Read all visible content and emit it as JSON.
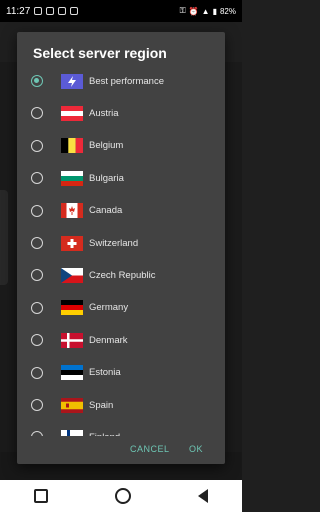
{
  "status": {
    "time": "11:27",
    "battery_text": "82%"
  },
  "dialog": {
    "title": "Select server region",
    "cancel_label": "CANCEL",
    "ok_label": "OK",
    "selected_index": 0
  },
  "regions": [
    {
      "label": "Best performance",
      "flag": "bolt"
    },
    {
      "label": "Austria",
      "flag": "at"
    },
    {
      "label": "Belgium",
      "flag": "be"
    },
    {
      "label": "Bulgaria",
      "flag": "bg"
    },
    {
      "label": "Canada",
      "flag": "ca"
    },
    {
      "label": "Switzerland",
      "flag": "ch"
    },
    {
      "label": "Czech Republic",
      "flag": "cz"
    },
    {
      "label": "Germany",
      "flag": "de"
    },
    {
      "label": "Denmark",
      "flag": "dk"
    },
    {
      "label": "Estonia",
      "flag": "ee"
    },
    {
      "label": "Spain",
      "flag": "es"
    },
    {
      "label": "Finland",
      "flag": "fi"
    }
  ]
}
